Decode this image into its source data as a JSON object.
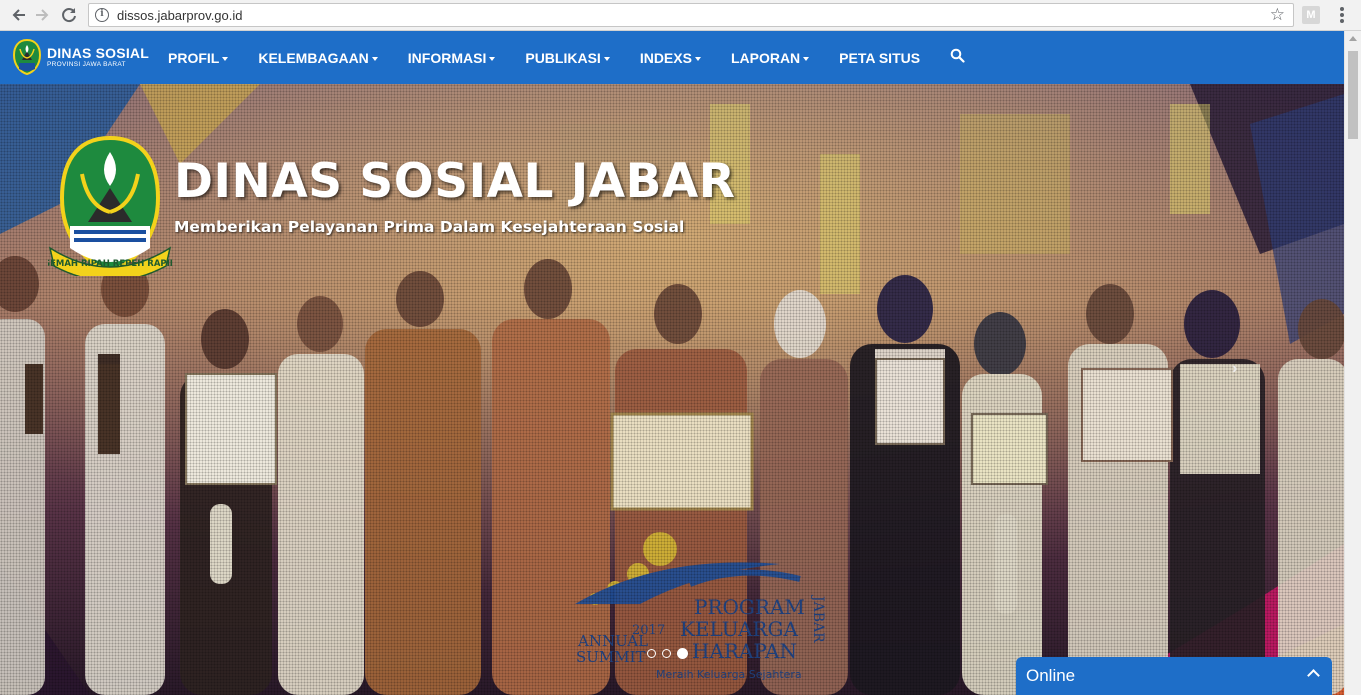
{
  "browser": {
    "url": "dissos.jabarprov.go.id",
    "back_icon": "arrow-left-icon",
    "forward_icon": "arrow-right-icon",
    "reload_icon": "reload-icon",
    "info_icon": "info-icon",
    "info_glyph": "i",
    "bookmark_icon": "star-icon",
    "extension_label": "M",
    "menu_icon": "kebab-menu-icon"
  },
  "navbar": {
    "brand_name": "DINAS SOSIAL",
    "brand_sub": "PROVINSI JAWA BARAT",
    "bg_color": "#1e6ec8",
    "items": [
      {
        "label": "PROFIL",
        "dropdown": true
      },
      {
        "label": "KELEMBAGAAN",
        "dropdown": true
      },
      {
        "label": "INFORMASI",
        "dropdown": true
      },
      {
        "label": "PUBLIKASI",
        "dropdown": true
      },
      {
        "label": "INDEXS",
        "dropdown": true
      },
      {
        "label": "LAPORAN",
        "dropdown": true
      },
      {
        "label": "PETA SITUS",
        "dropdown": false
      }
    ],
    "search_icon": "search-icon"
  },
  "hero": {
    "title": "DINAS SOSIAL JABAR",
    "subtitle": "Memberikan Pelayanan Prima Dalam Kesejahteraan Sosial",
    "emblem_motto": "GEMAH RIPAH REPEH RAPIH",
    "next_glyph": "›",
    "slides_total": 3,
    "active_slide": 3,
    "watermark": {
      "line1": "PROGRAM",
      "line2": "KELUARGA",
      "line3": "HARAPAN",
      "side": "JABAR",
      "year": "2017",
      "event1": "ANNUAL",
      "event2": "SUMMIT",
      "tagline": "Meraih Keluarga Sejahtera"
    }
  },
  "chat": {
    "label": "Online",
    "toggle_icon": "chevron-up-icon",
    "color": "#1e6ec8"
  }
}
